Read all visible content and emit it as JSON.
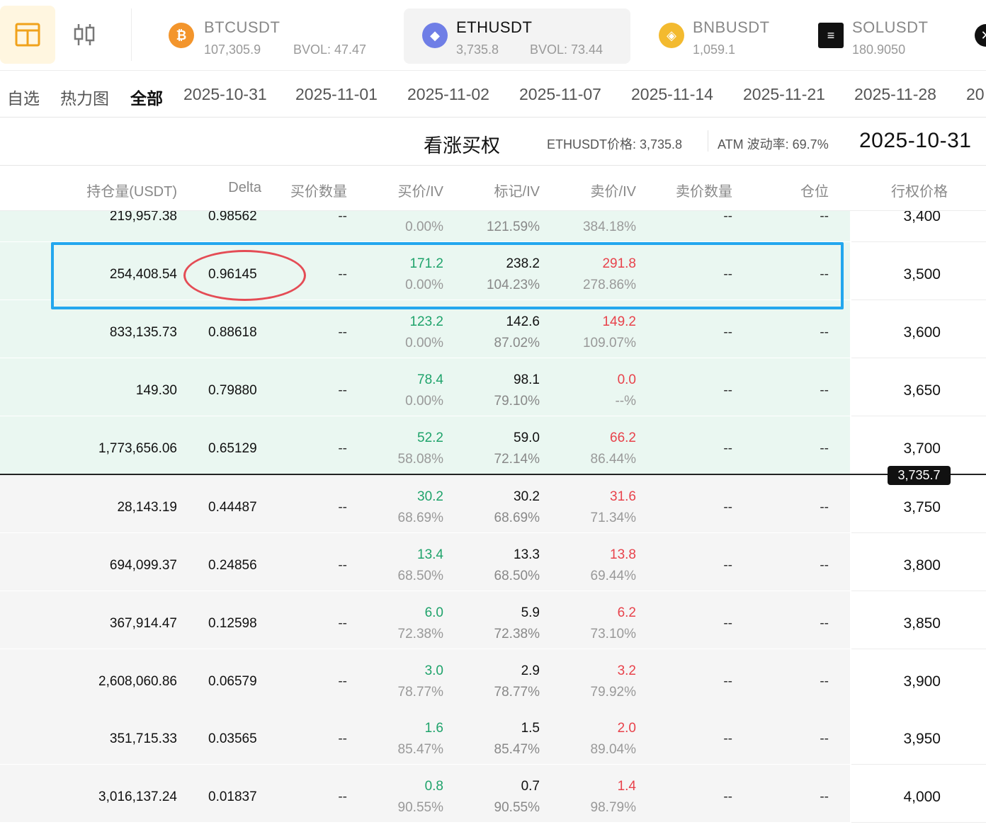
{
  "topbar": {
    "tickers": [
      {
        "symbol": "BTCUSDT",
        "price": "107,305.9",
        "bvol": "BVOL: 47.47",
        "coin_icon": "bitcoin-icon",
        "color": "#f3952c",
        "glyph": "₿"
      },
      {
        "symbol": "ETHUSDT",
        "price": "3,735.8",
        "bvol": "BVOL: 73.44",
        "coin_icon": "ethereum-icon",
        "color": "#6f7ee6",
        "glyph": "◆"
      },
      {
        "symbol": "BNBUSDT",
        "price": "1,059.1",
        "bvol": "",
        "coin_icon": "bnb-icon",
        "color": "#f3ba2f",
        "glyph": "◈"
      },
      {
        "symbol": "SOLUSDT",
        "price": "180.9050",
        "bvol": "",
        "coin_icon": "solana-icon",
        "color": "#111111",
        "glyph": "≡"
      }
    ],
    "icons": [
      "layout-icon",
      "candlestick-icon",
      "close-icon"
    ]
  },
  "tabs": [
    "自选",
    "热力图",
    "全部",
    "2025-10-31",
    "2025-11-01",
    "2025-11-02",
    "2025-11-07",
    "2025-11-14",
    "2025-11-21",
    "2025-11-28",
    "20"
  ],
  "active_tab": "全部",
  "header": {
    "title": "看涨买权",
    "price_label": "ETHUSDT价格: 3,735.8",
    "atm_label": "ATM 波动率: 69.7%",
    "expiry": "2025-10-31"
  },
  "columns": [
    "持仓量(USDT)",
    "Delta",
    "买价数量",
    "买价/IV",
    "标记/IV",
    "卖价/IV",
    "卖价数量",
    "仓位",
    "行权价格"
  ],
  "spot_badge": "3,735.7",
  "colors": {
    "bid": "#1fa36b",
    "ask": "#e8424b",
    "itm_bg": "#eaf7f1",
    "otm_bg": "#f5f5f5",
    "highlight_box": "#23a7ee",
    "highlight_circle": "#e44c55",
    "active_layout_bg": "#fff6e0"
  },
  "rows": [
    {
      "oi": "219,957.38",
      "delta": "0.98562",
      "bid_qty": "--",
      "bid": "",
      "bid_iv": "0.00%",
      "mark": "",
      "mark_iv": "121.59%",
      "ask": "",
      "ask_iv": "384.18%",
      "ask_qty": "--",
      "position": "--",
      "strike": "3,400",
      "itm": true
    },
    {
      "oi": "254,408.54",
      "delta": "0.96145",
      "bid_qty": "--",
      "bid": "171.2",
      "bid_iv": "0.00%",
      "mark": "238.2",
      "mark_iv": "104.23%",
      "ask": "291.8",
      "ask_iv": "278.86%",
      "ask_qty": "--",
      "position": "--",
      "strike": "3,500",
      "itm": true
    },
    {
      "oi": "833,135.73",
      "delta": "0.88618",
      "bid_qty": "--",
      "bid": "123.2",
      "bid_iv": "0.00%",
      "mark": "142.6",
      "mark_iv": "87.02%",
      "ask": "149.2",
      "ask_iv": "109.07%",
      "ask_qty": "--",
      "position": "--",
      "strike": "3,600",
      "itm": true
    },
    {
      "oi": "149.30",
      "delta": "0.79880",
      "bid_qty": "--",
      "bid": "78.4",
      "bid_iv": "0.00%",
      "mark": "98.1",
      "mark_iv": "79.10%",
      "ask": "0.0",
      "ask_iv": "--%",
      "ask_qty": "--",
      "position": "--",
      "strike": "3,650",
      "itm": true
    },
    {
      "oi": "1,773,656.06",
      "delta": "0.65129",
      "bid_qty": "--",
      "bid": "52.2",
      "bid_iv": "58.08%",
      "mark": "59.0",
      "mark_iv": "72.14%",
      "ask": "66.2",
      "ask_iv": "86.44%",
      "ask_qty": "--",
      "position": "--",
      "strike": "3,700",
      "itm": true
    },
    {
      "oi": "28,143.19",
      "delta": "0.44487",
      "bid_qty": "--",
      "bid": "30.2",
      "bid_iv": "68.69%",
      "mark": "30.2",
      "mark_iv": "68.69%",
      "ask": "31.6",
      "ask_iv": "71.34%",
      "ask_qty": "--",
      "position": "--",
      "strike": "3,750",
      "itm": false
    },
    {
      "oi": "694,099.37",
      "delta": "0.24856",
      "bid_qty": "--",
      "bid": "13.4",
      "bid_iv": "68.50%",
      "mark": "13.3",
      "mark_iv": "68.50%",
      "ask": "13.8",
      "ask_iv": "69.44%",
      "ask_qty": "--",
      "position": "--",
      "strike": "3,800",
      "itm": false
    },
    {
      "oi": "367,914.47",
      "delta": "0.12598",
      "bid_qty": "--",
      "bid": "6.0",
      "bid_iv": "72.38%",
      "mark": "5.9",
      "mark_iv": "72.38%",
      "ask": "6.2",
      "ask_iv": "73.10%",
      "ask_qty": "--",
      "position": "--",
      "strike": "3,850",
      "itm": false
    },
    {
      "oi": "2,608,060.86",
      "delta": "0.06579",
      "bid_qty": "--",
      "bid": "3.0",
      "bid_iv": "78.77%",
      "mark": "2.9",
      "mark_iv": "78.77%",
      "ask": "3.2",
      "ask_iv": "79.92%",
      "ask_qty": "--",
      "position": "--",
      "strike": "3,900",
      "itm": false
    },
    {
      "oi": "351,715.33",
      "delta": "0.03565",
      "bid_qty": "--",
      "bid": "1.6",
      "bid_iv": "85.47%",
      "mark": "1.5",
      "mark_iv": "85.47%",
      "ask": "2.0",
      "ask_iv": "89.04%",
      "ask_qty": "--",
      "position": "--",
      "strike": "3,950",
      "itm": false
    },
    {
      "oi": "3,016,137.24",
      "delta": "0.01837",
      "bid_qty": "--",
      "bid": "0.8",
      "bid_iv": "90.55%",
      "mark": "0.7",
      "mark_iv": "90.55%",
      "ask": "1.4",
      "ask_iv": "98.79%",
      "ask_qty": "--",
      "position": "--",
      "strike": "4,000",
      "itm": false
    }
  ]
}
